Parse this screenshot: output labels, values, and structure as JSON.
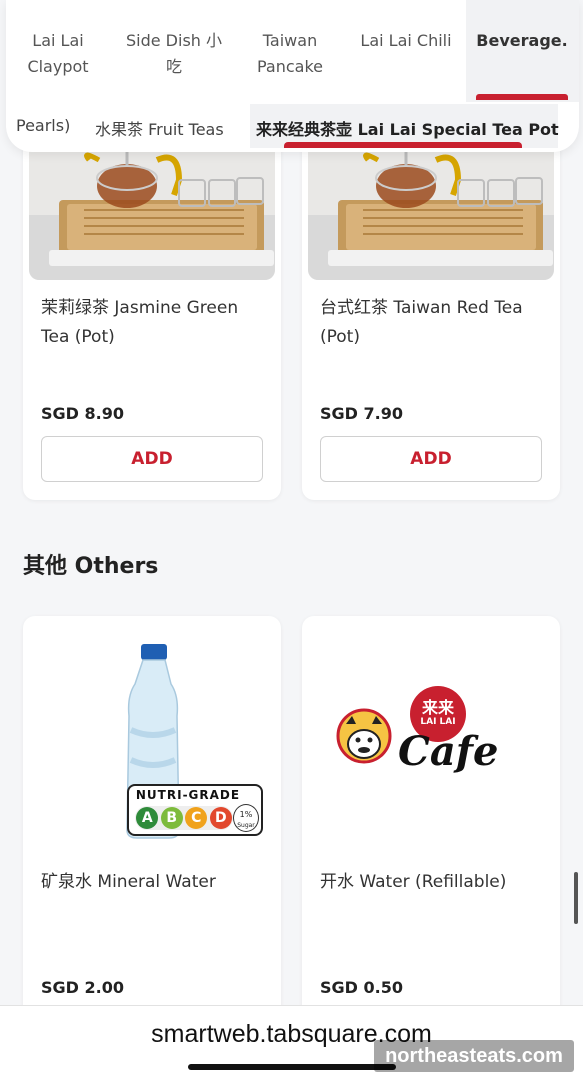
{
  "categories": [
    {
      "label": "Lai Lai\nClaypot"
    },
    {
      "label": "Side Dish 小\n吃"
    },
    {
      "label": "Taiwan\nPancake"
    },
    {
      "label": "Lai Lai Chili"
    },
    {
      "label": "Beverage."
    }
  ],
  "subcategories": [
    {
      "label": "Pearls)"
    },
    {
      "label": "水果茶 Fruit Teas"
    },
    {
      "label": "来来经典茶壶 Lai Lai Special Tea Pot"
    }
  ],
  "products": [
    {
      "name": "茉莉绿茶 Jasmine Green Tea (Pot)",
      "price": "SGD 8.90",
      "add": "ADD"
    },
    {
      "name": "台式红茶 Taiwan Red Tea (Pot)",
      "price": "SGD 7.90",
      "add": "ADD"
    },
    {
      "name": "矿泉水 Mineral Water",
      "price": "SGD 2.00"
    },
    {
      "name": "开水 Water (Refillable)",
      "price": "SGD 0.50"
    }
  ],
  "section": {
    "title": "其他 Others"
  },
  "nutri": {
    "title": "NUTRI-GRADE",
    "grades": [
      "A",
      "B",
      "C",
      "D"
    ],
    "sugar_value": "1%",
    "sugar_label": "Sugar"
  },
  "logo": {
    "seal": "来来",
    "sub": "LAI LAI",
    "word": "Cafe"
  },
  "footer": {
    "url": "smartweb.tabsquare.com",
    "watermark": "northeasteats.com"
  },
  "colors": {
    "accent": "#c8202f",
    "grade_a": "#2e8b3a",
    "grade_b": "#7dbb3c",
    "grade_c": "#f0a21c",
    "grade_d": "#e2482d"
  }
}
